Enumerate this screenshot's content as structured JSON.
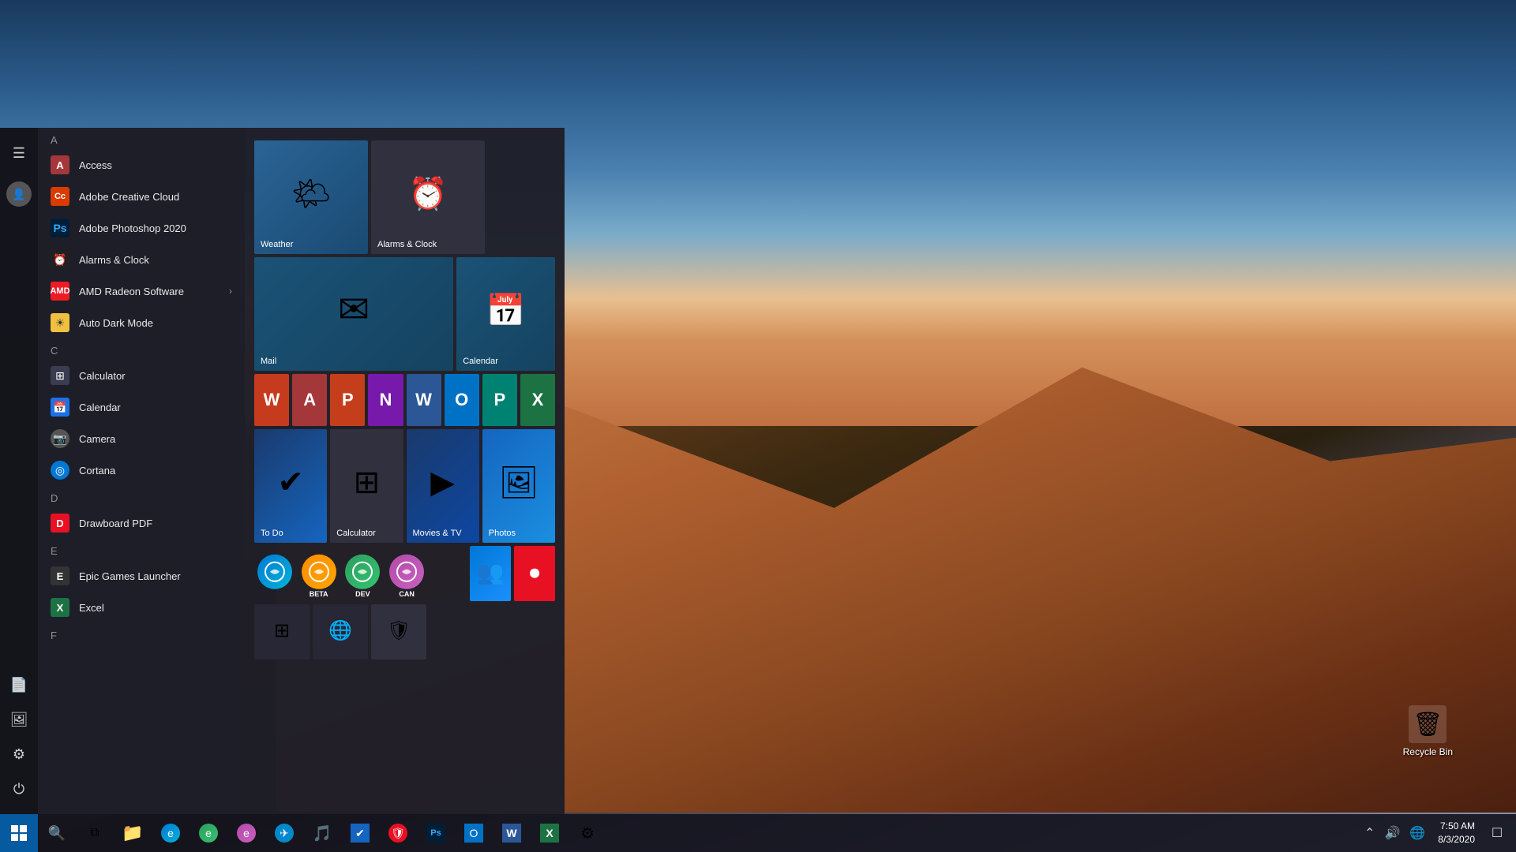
{
  "desktop": {
    "recycle_bin_label": "Recycle Bin"
  },
  "taskbar": {
    "time": "7:50 AM",
    "date": "8/3/2020",
    "apps": [
      {
        "name": "File Explorer",
        "icon": "📁"
      },
      {
        "name": "Edge",
        "icon": "🌐"
      },
      {
        "name": "Edge Dev",
        "icon": "🌐"
      },
      {
        "name": "Edge Canary",
        "icon": "🌐"
      },
      {
        "name": "Telegram",
        "icon": "✈"
      },
      {
        "name": "Music",
        "icon": "🎵"
      },
      {
        "name": "To Do",
        "icon": "✔"
      },
      {
        "name": "Antivirus",
        "icon": "🛡"
      },
      {
        "name": "Photoshop",
        "icon": "Ps"
      },
      {
        "name": "Outlook",
        "icon": "📧"
      },
      {
        "name": "Word",
        "icon": "W"
      },
      {
        "name": "Excel",
        "icon": "X"
      },
      {
        "name": "Settings",
        "icon": "⚙"
      }
    ]
  },
  "start_menu": {
    "left_bar": {
      "icons": [
        "☰",
        "👤",
        "📄",
        "🖼",
        "⚙",
        "⏻"
      ]
    },
    "app_list": {
      "sections": [
        {
          "letter": "A",
          "apps": [
            {
              "name": "Access",
              "icon": "A",
              "icon_class": "icon-access"
            },
            {
              "name": "Adobe Creative Cloud",
              "icon": "Cc",
              "icon_class": "icon-acc-cloud"
            },
            {
              "name": "Adobe Photoshop 2020",
              "icon": "Ps",
              "icon_class": "icon-ps"
            },
            {
              "name": "Alarms & Clock",
              "icon": "⏰",
              "icon_class": "icon-alarms"
            },
            {
              "name": "AMD Radeon Software",
              "icon": "R",
              "icon_class": "icon-amd",
              "expandable": true
            },
            {
              "name": "Auto Dark Mode",
              "icon": "☀",
              "icon_class": "icon-auto-dark"
            }
          ]
        },
        {
          "letter": "C",
          "apps": [
            {
              "name": "Calculator",
              "icon": "⊞",
              "icon_class": "icon-calculator"
            },
            {
              "name": "Calendar",
              "icon": "📅",
              "icon_class": "icon-calendar"
            },
            {
              "name": "Camera",
              "icon": "📷",
              "icon_class": "icon-camera"
            },
            {
              "name": "Cortana",
              "icon": "◎",
              "icon_class": "icon-cortana"
            }
          ]
        },
        {
          "letter": "D",
          "apps": [
            {
              "name": "Drawboard PDF",
              "icon": "D",
              "icon_class": "icon-drawboard"
            }
          ]
        },
        {
          "letter": "E",
          "apps": [
            {
              "name": "Epic Games Launcher",
              "icon": "E",
              "icon_class": "icon-epic"
            },
            {
              "name": "Excel",
              "icon": "X",
              "icon_class": "icon-excel"
            }
          ]
        },
        {
          "letter": "F",
          "apps": []
        }
      ]
    },
    "tiles": {
      "row1": [
        {
          "name": "Weather",
          "size": "small",
          "tile_class": "tile-weather",
          "icon": "🌤"
        },
        {
          "name": "Alarms & Clock",
          "size": "small",
          "tile_class": "tile-alarms",
          "icon": "⏰"
        }
      ],
      "row2": [
        {
          "name": "Mail",
          "size": "medium",
          "tile_class": "tile-mail",
          "icon": "✉"
        },
        {
          "name": "Calendar",
          "size": "medium",
          "tile_class": "tile-calendar",
          "icon": "📅"
        }
      ],
      "office_row": [
        {
          "name": "Word",
          "color": "#c63b1e"
        },
        {
          "name": "Access",
          "color": "#a4373a"
        },
        {
          "name": "PowerPoint",
          "color": "#c43e1c"
        },
        {
          "name": "OneNote",
          "color": "#7719aa"
        },
        {
          "name": "Word2",
          "color": "#2b5797"
        },
        {
          "name": "Outlook",
          "color": "#0072c6"
        },
        {
          "name": "Publisher",
          "color": "#008272"
        },
        {
          "name": "Excel",
          "color": "#1d7244"
        }
      ],
      "row3": [
        {
          "name": "To Do",
          "size": "small",
          "tile_class": "tile-todo",
          "icon": "✔"
        },
        {
          "name": "Calculator",
          "size": "small",
          "tile_class": "tile-calc",
          "icon": "⊞"
        },
        {
          "name": "Movies & TV",
          "size": "small",
          "tile_class": "tile-movies",
          "icon": "▶"
        },
        {
          "name": "Photos",
          "size": "small",
          "tile_class": "tile-photos",
          "icon": "🖼"
        }
      ],
      "edge_row": [
        {
          "name": "Edge Stable",
          "badge": "",
          "tile_class": "edge-stable"
        },
        {
          "name": "Edge Beta",
          "badge": "BETA",
          "tile_class": "edge-beta"
        },
        {
          "name": "Edge Dev",
          "badge": "DEV",
          "tile_class": "edge-dev"
        },
        {
          "name": "Edge Canary",
          "badge": "CAN",
          "tile_class": "edge-can"
        }
      ],
      "people_row": [
        {
          "name": "People",
          "tile_class": "tile-people",
          "icon": "👥"
        },
        {
          "name": "Dot",
          "tile_class": "tile-dot",
          "icon": "●"
        }
      ],
      "bottom_row": [
        {
          "name": "App1",
          "icon": "⊞"
        },
        {
          "name": "App2",
          "icon": "🌐"
        },
        {
          "name": "App3",
          "icon": "🛡"
        }
      ]
    }
  }
}
